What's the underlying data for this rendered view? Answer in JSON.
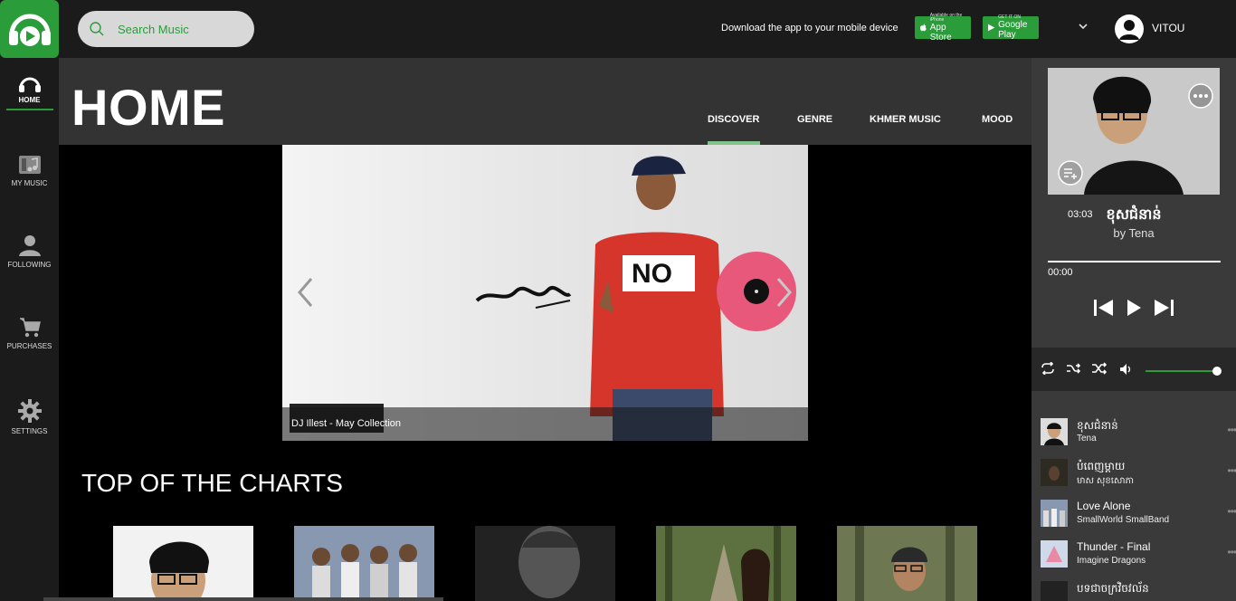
{
  "search": {
    "placeholder": "Search Music"
  },
  "topbar": {
    "download_text": "Download the app to your mobile device",
    "app_store": {
      "small": "Available on the iPhone",
      "label": "App Store"
    },
    "google_play": {
      "small": "GET IT ON",
      "label": "Google Play"
    },
    "username": "VITOU"
  },
  "nav": [
    {
      "label": "HOME",
      "icon": "headphones-icon",
      "active": true
    },
    {
      "label": "MY MUSIC",
      "icon": "music-library-icon"
    },
    {
      "label": "FOLLOWING",
      "icon": "person-icon"
    },
    {
      "label": "PURCHASES",
      "icon": "cart-icon"
    },
    {
      "label": "SETTINGS",
      "icon": "gear-icon"
    }
  ],
  "header": {
    "title": "HOME",
    "tabs": [
      "DISCOVER",
      "GENRE",
      "KHMER MUSIC",
      "MOOD"
    ],
    "active_tab": "DISCOVER"
  },
  "hero": {
    "caption": "DJ Illest - May Collection"
  },
  "charts": {
    "title": "TOP OF THE CHARTS"
  },
  "player": {
    "title": "ខុសជំនាន់",
    "artist": "by Tena",
    "time_current": "00:00",
    "time_total": "03:03",
    "volume_level": 0.96
  },
  "queue": [
    {
      "title": "ខុសជំនាន់",
      "artist": "Tena"
    },
    {
      "title": "បំពេញម្ដាយ",
      "artist": "មាស សុខសោភា"
    },
    {
      "title": "Love Alone",
      "artist": "SmallWorld SmallBand"
    },
    {
      "title": "Thunder - Final",
      "artist": "Imagine Dragons"
    },
    {
      "title": "បទជាចក្រវិចវល័ន",
      "artist": ""
    }
  ],
  "colors": {
    "accent": "#2a9d3a",
    "topbar": "#1b1b1b",
    "panel": "#3a3a3a"
  }
}
